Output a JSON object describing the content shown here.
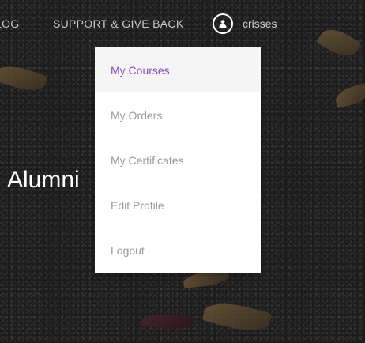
{
  "nav": {
    "items": [
      {
        "label": "LOG"
      },
      {
        "label": "SUPPORT & GIVE BACK"
      }
    ]
  },
  "user": {
    "name": "crisses",
    "avatar_icon": "user-icon"
  },
  "hero": {
    "title": "Alumni"
  },
  "dropdown": {
    "items": [
      {
        "label": "My Courses",
        "active": true
      },
      {
        "label": "My Orders",
        "active": false
      },
      {
        "label": "My Certificates",
        "active": false
      },
      {
        "label": "Edit Profile",
        "active": false
      },
      {
        "label": "Logout",
        "active": false
      }
    ]
  },
  "colors": {
    "accent": "#8b4ec7",
    "menu_text": "#9a9a9a",
    "active_bg": "#f5f5f5"
  }
}
